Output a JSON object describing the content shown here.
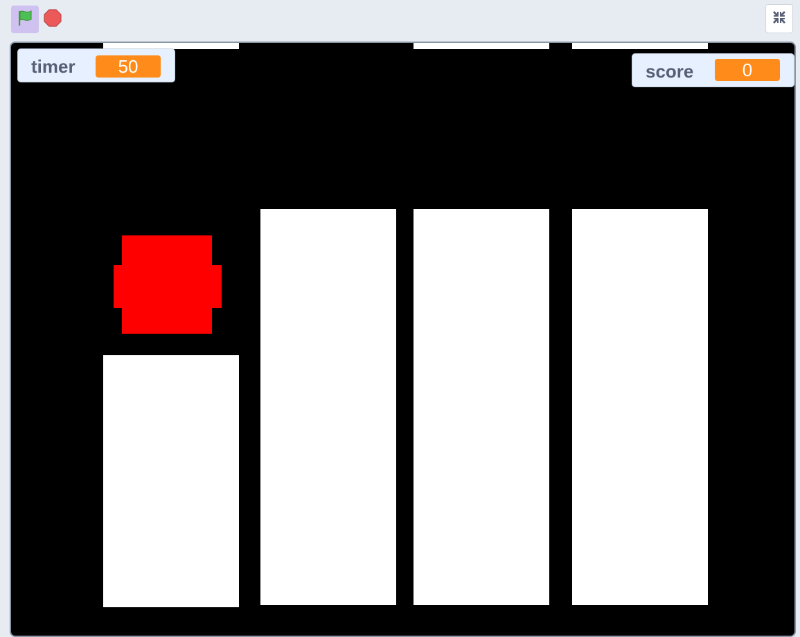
{
  "toolbar": {
    "green_flag": {
      "icon": "green-flag-icon",
      "color": "#4cbf56",
      "active_bg": "#cfc2f0"
    },
    "stop": {
      "icon": "stop-sign-icon",
      "color": "#ec5959"
    },
    "fullscreen": {
      "icon": "exit-fullscreen-icon",
      "color": "#575e75"
    }
  },
  "stage": {
    "background": "#000000",
    "player": {
      "color": "#ff0000"
    }
  },
  "monitors": {
    "timer": {
      "label": "timer",
      "value": "50"
    },
    "score": {
      "label": "score",
      "value": "0"
    }
  },
  "colors": {
    "monitor_value": "#ff8c1a",
    "monitor_bg": "#e6f0ff",
    "label_text": "#575e75"
  }
}
